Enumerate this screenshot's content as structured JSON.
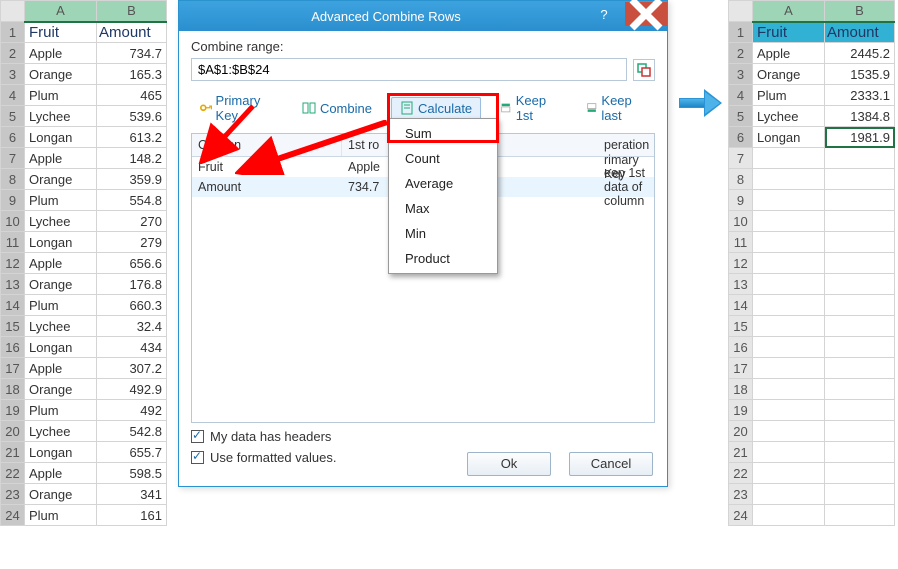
{
  "left_sheet": {
    "columns": [
      "A",
      "B"
    ],
    "headers": [
      "Fruit",
      "Amount"
    ],
    "rows": [
      {
        "fruit": "Apple",
        "amount": "734.7"
      },
      {
        "fruit": "Orange",
        "amount": "165.3"
      },
      {
        "fruit": "Plum",
        "amount": "465"
      },
      {
        "fruit": "Lychee",
        "amount": "539.6"
      },
      {
        "fruit": "Longan",
        "amount": "613.2"
      },
      {
        "fruit": "Apple",
        "amount": "148.2"
      },
      {
        "fruit": "Orange",
        "amount": "359.9"
      },
      {
        "fruit": "Plum",
        "amount": "554.8"
      },
      {
        "fruit": "Lychee",
        "amount": "270"
      },
      {
        "fruit": "Longan",
        "amount": "279"
      },
      {
        "fruit": "Apple",
        "amount": "656.6"
      },
      {
        "fruit": "Orange",
        "amount": "176.8"
      },
      {
        "fruit": "Plum",
        "amount": "660.3"
      },
      {
        "fruit": "Lychee",
        "amount": "32.4"
      },
      {
        "fruit": "Longan",
        "amount": "434"
      },
      {
        "fruit": "Apple",
        "amount": "307.2"
      },
      {
        "fruit": "Orange",
        "amount": "492.9"
      },
      {
        "fruit": "Plum",
        "amount": "492"
      },
      {
        "fruit": "Lychee",
        "amount": "542.8"
      },
      {
        "fruit": "Longan",
        "amount": "655.7"
      },
      {
        "fruit": "Apple",
        "amount": "598.5"
      },
      {
        "fruit": "Orange",
        "amount": "341"
      },
      {
        "fruit": "Plum",
        "amount": "161"
      }
    ]
  },
  "right_sheet": {
    "columns": [
      "A",
      "B"
    ],
    "headers": [
      "Fruit",
      "Amount"
    ],
    "rows": [
      {
        "fruit": "Apple",
        "amount": "2445.2"
      },
      {
        "fruit": "Orange",
        "amount": "1535.9"
      },
      {
        "fruit": "Plum",
        "amount": "2333.1"
      },
      {
        "fruit": "Lychee",
        "amount": "1384.8"
      },
      {
        "fruit": "Longan",
        "amount": "1981.9"
      }
    ],
    "blank_rows": 18
  },
  "dialog": {
    "title": "Advanced Combine Rows",
    "combine_range_label": "Combine range:",
    "combine_range_value": "$A$1:$B$24",
    "toolbar": {
      "primary_key": "Primary Key",
      "combine": "Combine",
      "calculate": "Calculate",
      "keep_first": "Keep 1st",
      "keep_last": "Keep last"
    },
    "list": {
      "header_column": "Column",
      "header_firstrow": "1st row …",
      "header_operation": "Operation",
      "rows": [
        {
          "col": "Fruit",
          "first": "Apple",
          "op": "Primary Key"
        },
        {
          "col": "Amount",
          "first": "734.7",
          "op": "Keep 1st data of column"
        }
      ]
    },
    "check_headers": "My data has headers",
    "check_formatted": "Use formatted values.",
    "ok_label": "Ok",
    "cancel_label": "Cancel"
  },
  "dropdown": {
    "items": [
      "Sum",
      "Count",
      "Average",
      "Max",
      "Min",
      "Product"
    ]
  }
}
